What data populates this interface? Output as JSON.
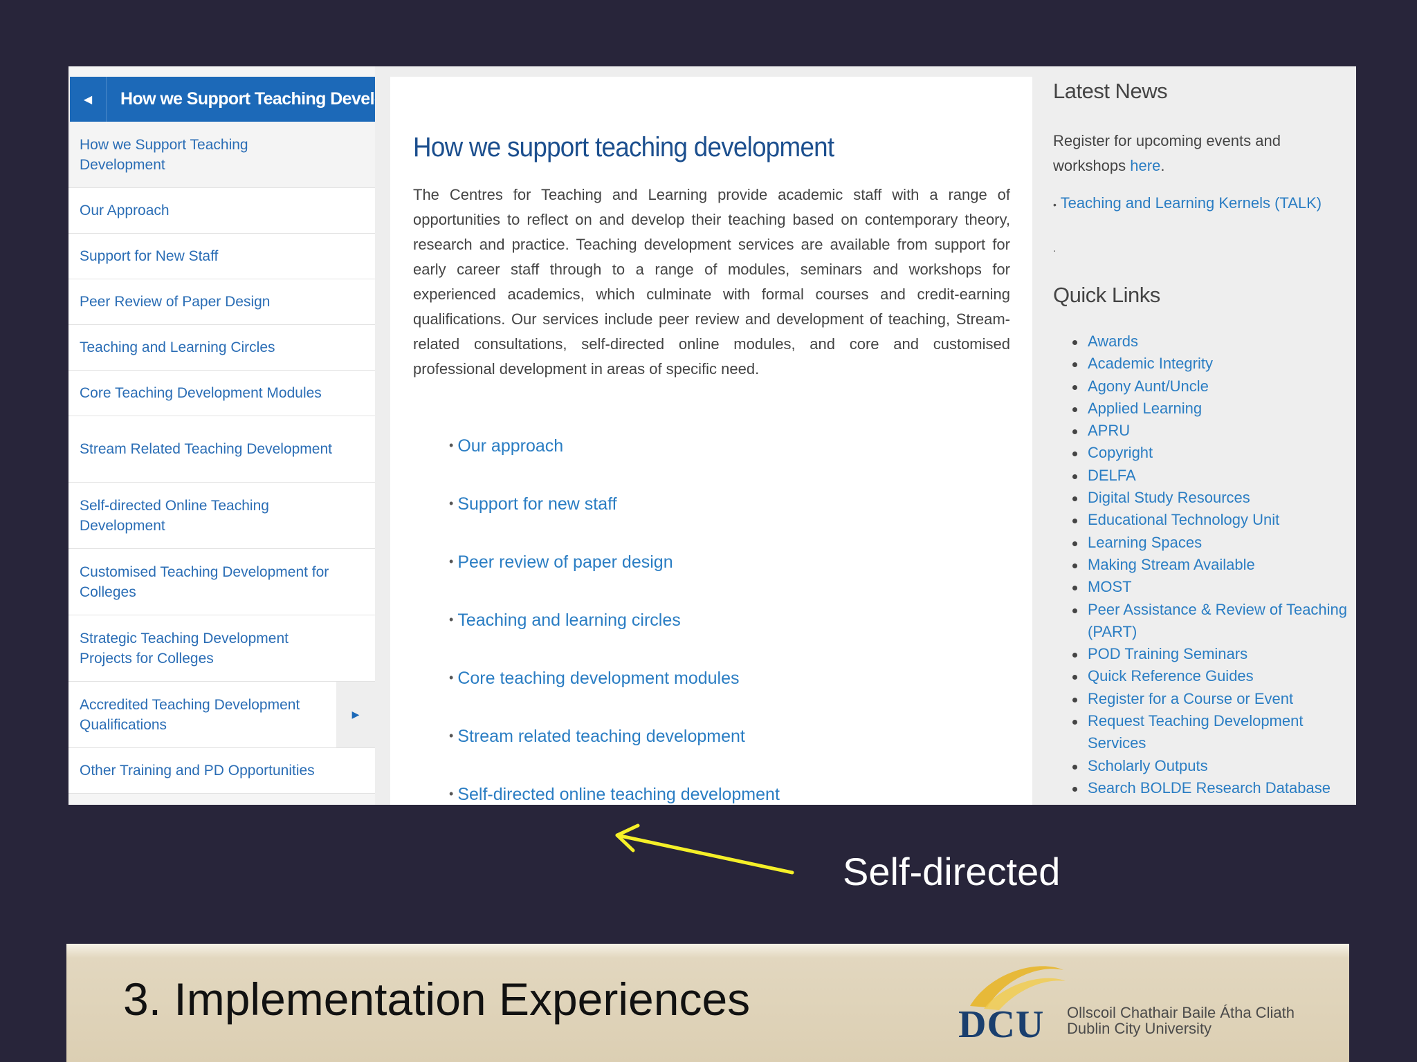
{
  "sidebar": {
    "header_title": "How we Support Teaching Development",
    "items": [
      {
        "label": "How we Support Teaching Development",
        "has_submenu": false
      },
      {
        "label": "Our Approach",
        "has_submenu": false
      },
      {
        "label": "Support for New Staff",
        "has_submenu": false
      },
      {
        "label": "Peer Review of Paper Design",
        "has_submenu": false
      },
      {
        "label": "Teaching and Learning Circles",
        "has_submenu": false
      },
      {
        "label": "Core Teaching Development Modules",
        "has_submenu": false
      },
      {
        "label": "Stream Related Teaching Development",
        "has_submenu": false
      },
      {
        "label": "Self-directed Online Teaching Development",
        "has_submenu": false
      },
      {
        "label": "Customised Teaching Development for Colleges",
        "has_submenu": false
      },
      {
        "label": "Strategic Teaching Development Projects for Colleges",
        "has_submenu": false
      },
      {
        "label": "Accredited Teaching Development Qualifications",
        "has_submenu": true
      },
      {
        "label": "Other Training and PD Opportunities",
        "has_submenu": false
      }
    ]
  },
  "main": {
    "title": "How we support teaching development",
    "body": "The Centres for Teaching and Learning provide academic staff with a range of opportunities to reflect on and develop their teaching based on contemporary theory, research and practice. Teaching development services are available from support for early career staff through to a range of modules, seminars and workshops for experienced academics, which culminate with formal courses and credit-earning qualifications. Our services include peer review and development of teaching, Stream-related consultations, self-directed online modules, and core and customised professional development in areas of specific need.",
    "links": [
      "Our approach",
      "Support for new staff",
      "Peer review of paper design",
      "Teaching and learning circles",
      "Core teaching development modules",
      "Stream related teaching development",
      "Self-directed online teaching development"
    ]
  },
  "right": {
    "news_heading": "Latest News",
    "news_text": "Register for upcoming events and workshops ",
    "news_link": "here",
    "news_text_end": ".",
    "talk_link": "Teaching and Learning Kernels (TALK)",
    "stray_dot": ".",
    "quick_heading": "Quick Links",
    "quick_links": [
      "Awards",
      "Academic Integrity",
      "Agony Aunt/Uncle",
      "Applied Learning",
      "APRU",
      "Copyright",
      "DELFA",
      "Digital Study Resources",
      "Educational Technology Unit",
      "Learning Spaces",
      "Making Stream Available",
      "MOST",
      "Peer Assistance & Review of Teaching (PART)",
      "POD Training Seminars",
      "Quick Reference Guides",
      "Register for a Course or Event",
      "Request Teaching Development Services",
      "Scholarly Outputs",
      "Search BOLDE Research Database"
    ]
  },
  "annotation": {
    "label": "Self-directed",
    "arrow_color": "#f5f028"
  },
  "footer": {
    "title": "3. Implementation Experiences",
    "logo_letters": "DCU",
    "university_irish": "Ollscoil Chathair Baile Átha Cliath",
    "university_english": "Dublin City University"
  },
  "colors": {
    "slide_background": "#28253a",
    "link_blue": "#2a7dc3",
    "header_blue": "#1c69b8",
    "title_navy": "#1c4f8e"
  }
}
